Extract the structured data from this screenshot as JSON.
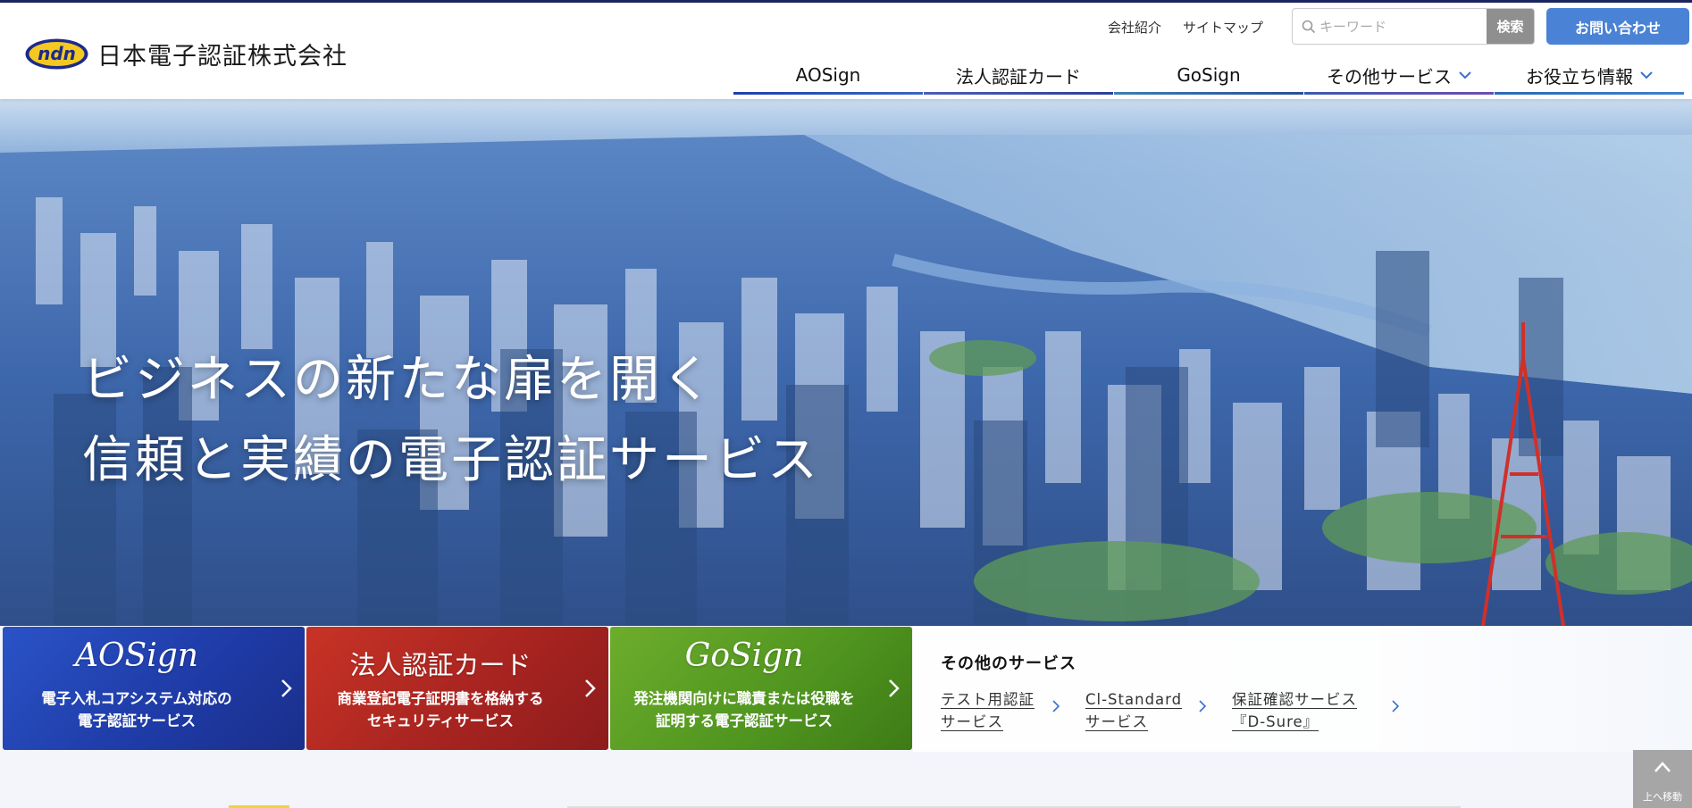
{
  "header": {
    "logo_mark": "ndn",
    "company_name": "日本電子認証株式会社",
    "utility_links": [
      "会社紹介",
      "サイトマップ"
    ],
    "search": {
      "placeholder": "キーワード",
      "button_label": "検索",
      "icon": "search-icon"
    },
    "contact_button": "お問い合わせ",
    "nav": [
      {
        "label": "AOSign",
        "accent": "#2b46b8"
      },
      {
        "label": "法人認証カード",
        "accent": "#3a52b0"
      },
      {
        "label": "GoSign",
        "accent": "#2f5c9e"
      },
      {
        "label": "その他サービス",
        "accent": "#3a4fa8",
        "icon": "chevron-down-icon"
      },
      {
        "label": "お役立ち情報",
        "accent": "#2c66b5",
        "icon": "chevron-down-icon"
      }
    ]
  },
  "hero": {
    "headline_line1": "ビジネスの新たな扉を開く",
    "headline_line2": "信頼と実績の電子認証サービス"
  },
  "service_cards": [
    {
      "title": "AOSign",
      "subtitle": "電子入札コアシステム対応の\n電子認証サービス",
      "color": "#2344b8",
      "icon": "chevron-right-icon"
    },
    {
      "title": "法人認証カード",
      "subtitle": "商業登記電子証明書を格納する\nセキュリティサービス",
      "color": "#b02822",
      "icon": "chevron-right-icon"
    },
    {
      "title": "GoSign",
      "subtitle": "発注機関向けに職責または役職を\n証明する電子認証サービス",
      "color": "#5aa024",
      "icon": "chevron-right-icon"
    }
  ],
  "other_services": {
    "title": "その他のサービス",
    "links": [
      {
        "label": "テスト用認証\nサービス",
        "icon": "chevron-right-icon"
      },
      {
        "label": "Cl-Standard\nサービス",
        "icon": "chevron-right-icon"
      },
      {
        "label": "保証確認サービス\n『D-Sure』",
        "icon": "chevron-right-icon"
      }
    ]
  },
  "back_to_top": {
    "label": "上へ移動",
    "icon": "chevron-up-icon"
  },
  "colors": {
    "top_line": "#1b2560",
    "contact": "#4a83d6",
    "search_button": "#8f8f8f",
    "chevron": "#3a6fd0"
  }
}
